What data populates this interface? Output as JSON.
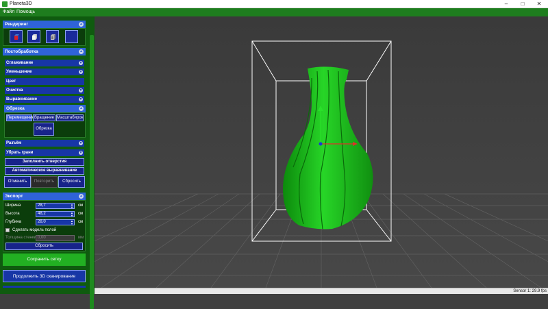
{
  "window": {
    "title": "Planeta3D",
    "minimize": "–",
    "maximize": "□",
    "close": "✕"
  },
  "menu": [
    "Файл",
    "Помощь"
  ],
  "render": {
    "title": "Рендеринг",
    "toggle": "▲"
  },
  "post": {
    "title": "Постобработка",
    "toggle": "▲",
    "items": [
      {
        "label": "Сглаживание",
        "toggle": "▼"
      },
      {
        "label": "Уменьшение",
        "toggle": "▼"
      },
      {
        "label": "Цвет"
      },
      {
        "label": "Очистка",
        "toggle": "▼"
      },
      {
        "label": "Выравнивание",
        "toggle": "▼"
      }
    ],
    "crop": {
      "title": "Обрезка",
      "toggle": "▲",
      "tools": [
        "Перемещение",
        "Вращение",
        "Масштабировани"
      ],
      "crop_button": "Обрезка"
    },
    "items2": [
      {
        "label": "Разъём",
        "toggle": "▼"
      },
      {
        "label": "Убрать грани",
        "toggle": "▼"
      }
    ],
    "fill_holes": "Заполнить отверстия",
    "auto_align": "Автоматическое выравнивание",
    "cancel": "Отменить",
    "redo": "Повторить",
    "reset": "Сбросить"
  },
  "export": {
    "title": "Экспорт",
    "toggle": "▲",
    "width_label": "Ширина",
    "width_value": "28,7",
    "height_label": "Высота",
    "height_value": "48,2",
    "depth_label": "Глубина",
    "depth_value": "28,0",
    "unit": "см",
    "hollow_label": "Сделать модель полой",
    "wall_label": "Толщина стенки",
    "wall_value": "0,00",
    "wall_unit": "мм",
    "reset": "Сбросить"
  },
  "save_mesh": "Сохранить сетку",
  "continue_scan": "Продолжить 3D сканирование",
  "status": "Sensor 1: 29.9 fps",
  "colors": {
    "sidebar": "#0f5b0f",
    "section": "#2f63d8",
    "button": "#17238a",
    "model": "#1fbf1f",
    "save": "#22b022"
  },
  "icons": {
    "minimize": "minimize-icon",
    "maximize": "maximize-icon",
    "close": "close-icon",
    "render_modes": [
      "colored-cube-icon",
      "white-cube-icon",
      "gray-cube-icon",
      "empty-icon"
    ]
  }
}
